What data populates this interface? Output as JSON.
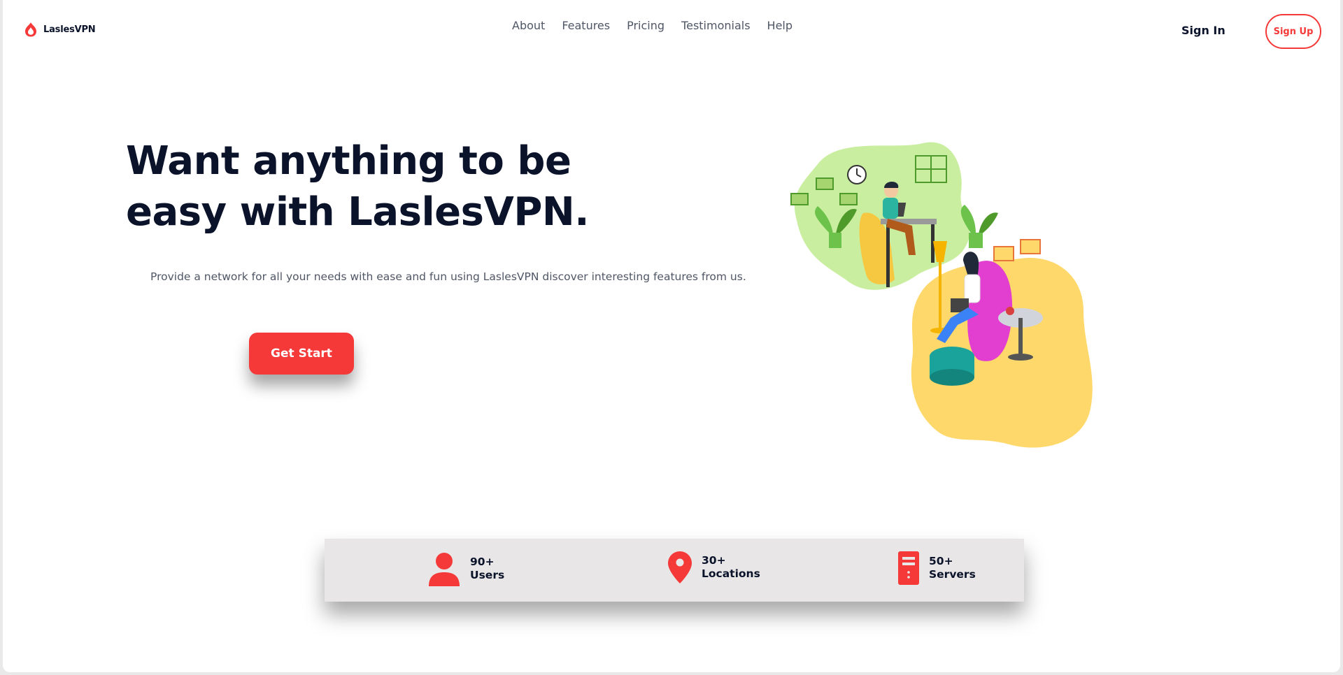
{
  "brand": {
    "name_part1": "Lasles",
    "name_part2": "VPN",
    "accent_color": "#f53838"
  },
  "nav": {
    "items": [
      {
        "label": "About"
      },
      {
        "label": "Features"
      },
      {
        "label": "Pricing"
      },
      {
        "label": "Testimonials"
      },
      {
        "label": "Help"
      }
    ],
    "sign_in": "Sign In",
    "sign_up": "Sign Up"
  },
  "hero": {
    "headline_line1": "Want anything to be",
    "headline_line2": "easy with LaslesVPN.",
    "subtitle": "Provide a network for all your needs with ease and fun using LaslesVPN discover interesting features from us.",
    "cta_label": "Get Start",
    "illustration": "people-working-illustration"
  },
  "stats": [
    {
      "icon": "user-icon",
      "value": "90+",
      "label": "Users"
    },
    {
      "icon": "location-pin-icon",
      "value": "30+",
      "label": "Locations"
    },
    {
      "icon": "server-icon",
      "value": "50+",
      "label": "Servers"
    }
  ]
}
